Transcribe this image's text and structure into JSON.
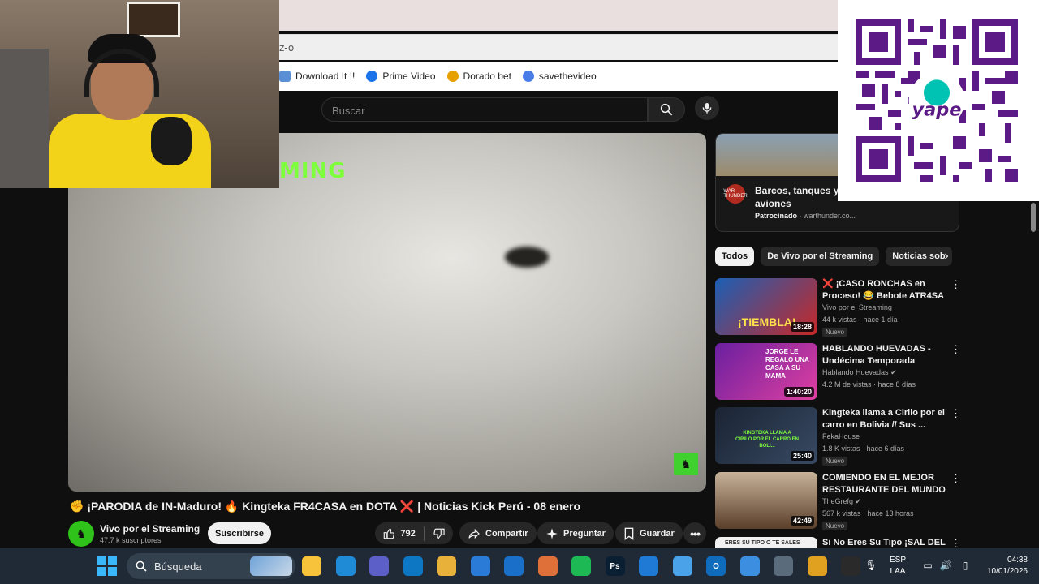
{
  "browser": {
    "address_text": "z-o",
    "bookmarks": [
      {
        "label": "Download It !!",
        "color": "#5a8fd6"
      },
      {
        "label": "Prime Video",
        "color": "#1a73e8"
      },
      {
        "label": "Dorado bet",
        "color": "#e6a100"
      },
      {
        "label": "savethevideo",
        "color": "#4a7de8"
      }
    ]
  },
  "overlay_text": "MING",
  "header": {
    "search_placeholder": "Buscar",
    "search_icon": "search-icon",
    "mic_icon": "microphone-icon"
  },
  "video": {
    "title": "✊ ¡PARODIA de IN-Maduro! 🔥 Kingteka FR4CASA en DOTA ❌ | Noticias Kick Perú - 08 enero",
    "channel_name": "Vivo por el Streaming",
    "subscribers": "47.7 k suscriptores",
    "subscribe_label": "Suscribirse",
    "likes": "792",
    "share_label": "Compartir",
    "ask_label": "Preguntar",
    "save_label": "Guardar"
  },
  "ad": {
    "title": "Barcos, tanques y aviones",
    "sponsored_label": "Patrocinado",
    "domain": "warthunder.co...",
    "logo_text": "WAR THUNDER"
  },
  "chips": [
    "Todos",
    "De Vivo por el Streaming",
    "Noticias sob"
  ],
  "recommendations": [
    {
      "title": "❌ ¡CASO RONCHAS en Proceso! 😂 Bebote ATR4SA ...",
      "channel": "Vivo por el Streaming",
      "stats": "44 k vistas · hace 1 día",
      "badge": "Nuevo",
      "duration": "18:28",
      "thumb_text": "¡TIEMBLA!",
      "colors": [
        "#1b5fb5",
        "#c62828"
      ]
    },
    {
      "title": "HABLANDO HUEVADAS - Undécima Temporada [JORGE ...",
      "channel": "Hablando Huevadas",
      "stats": "4.2 M de vistas · hace 8 días",
      "badge": "",
      "duration": "1:40:20",
      "thumb_text": "JORGE LE REGALO UNA CASA A SU MAMA",
      "colors": [
        "#6a1fa0",
        "#e040a0"
      ]
    },
    {
      "title": "Kingteka llama a Cirilo por el carro en Bolivia // Sus ...",
      "channel": "FekaHouse",
      "stats": "1.8 K vistas · hace 6 días",
      "badge": "Nuevo",
      "duration": "25:40",
      "thumb_text": "KINGTEKA LLAMA A CIRILO POR EL CARRO EN BOLI...",
      "colors": [
        "#1a2333",
        "#384a63"
      ]
    },
    {
      "title": "COMIENDO EN EL MEJOR RESTAURANTE DEL MUNDO",
      "channel": "TheGrefg",
      "stats": "567 k vistas · hace 13 horas",
      "badge": "Nuevo",
      "duration": "42:49",
      "thumb_text": "",
      "colors": [
        "#8a6a4a",
        "#3a2a1e"
      ]
    },
    {
      "title": "Si No Eres Su Tipo ¡SAL DEL",
      "channel": "",
      "stats": "",
      "badge": "",
      "duration": "",
      "thumb_text": "ERES SU TIPO O TE SALES",
      "colors": [
        "#f1f1f1",
        "#dddddd"
      ]
    }
  ],
  "qr": {
    "brand": "yape"
  },
  "taskbar": {
    "search_label": "Búsqueda",
    "apps": [
      {
        "name": "file-explorer-icon",
        "color": "#f6c33a",
        "glyph": ""
      },
      {
        "name": "edge-icon",
        "color": "#1f8ad6",
        "glyph": ""
      },
      {
        "name": "teams-icon",
        "color": "#5b5fc7",
        "glyph": ""
      },
      {
        "name": "chrome-edge-icon",
        "color": "#0d77c4",
        "glyph": ""
      },
      {
        "name": "folder-icon",
        "color": "#e8b23a",
        "glyph": ""
      },
      {
        "name": "store-icon",
        "color": "#2a7ad8",
        "glyph": ""
      },
      {
        "name": "mail-icon",
        "color": "#1a6fc9",
        "glyph": ""
      },
      {
        "name": "media-player-icon",
        "color": "#e0703a",
        "glyph": ""
      },
      {
        "name": "spotify-icon",
        "color": "#1db954",
        "glyph": ""
      },
      {
        "name": "photoshop-icon",
        "color": "#0b1f33",
        "glyph": "Ps"
      },
      {
        "name": "onedrive-icon",
        "color": "#1f7ad6",
        "glyph": ""
      },
      {
        "name": "notepad-icon",
        "color": "#4aa3e8",
        "glyph": ""
      },
      {
        "name": "outlook-icon",
        "color": "#0f6cbd",
        "glyph": "O"
      },
      {
        "name": "calendar-icon",
        "color": "#3b8ee0",
        "glyph": ""
      },
      {
        "name": "calculator-icon",
        "color": "#5a6b7b",
        "glyph": ""
      },
      {
        "name": "chrome-icon",
        "color": "#e0a020",
        "glyph": ""
      },
      {
        "name": "obs-icon",
        "color": "#2a2a2a",
        "glyph": ""
      }
    ],
    "lang_line1": "ESP",
    "lang_line2": "LAA",
    "time": "04:38",
    "date": "10/01/2026"
  }
}
